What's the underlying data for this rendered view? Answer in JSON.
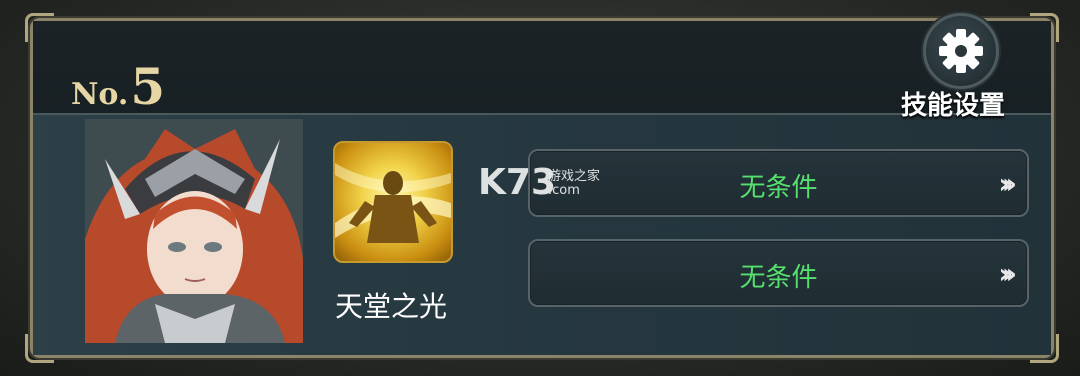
{
  "panel": {
    "rank_prefix": "No.",
    "rank_number": "5"
  },
  "settings": {
    "label": "技能设置",
    "icon": "gear-icon"
  },
  "skill": {
    "name": "天堂之光",
    "icon": "heavenly-light-skill-icon"
  },
  "conditions": [
    {
      "label": "无条件",
      "action_icon": "triple-chevron-right-icon"
    },
    {
      "label": "无条件",
      "action_icon": "triple-chevron-right-icon"
    }
  ],
  "watermark": {
    "logo": "K73",
    "site": "游戏之家",
    "domain": ".com"
  },
  "colors": {
    "frame_gold": "#8c8468",
    "rank_text": "#e6d6a6",
    "condition_text": "#55e06e",
    "skill_icon_gold": "#f2d34a"
  }
}
